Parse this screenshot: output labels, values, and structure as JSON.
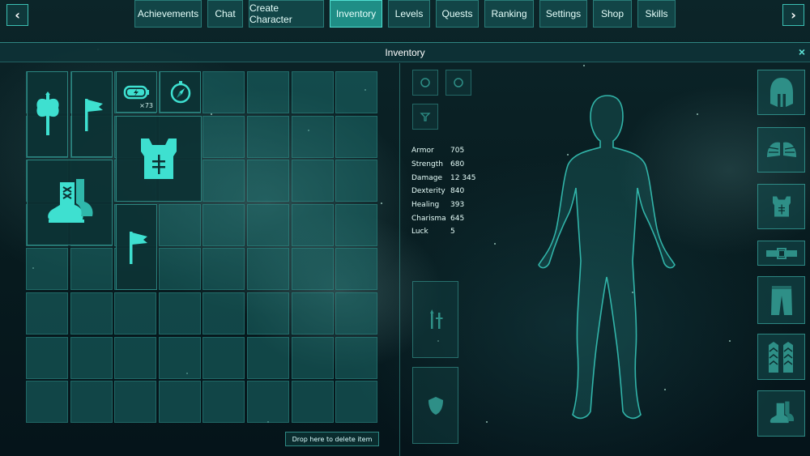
{
  "nav": {
    "prev_label": "‹",
    "next_label": "›",
    "tabs": [
      {
        "label": "Achievements",
        "active": false
      },
      {
        "label": "Chat",
        "active": false
      },
      {
        "label": "Create Character",
        "active": false
      },
      {
        "label": "Inventory",
        "active": true
      },
      {
        "label": "Levels",
        "active": false
      },
      {
        "label": "Quests",
        "active": false
      },
      {
        "label": "Ranking",
        "active": false
      },
      {
        "label": "Settings",
        "active": false
      },
      {
        "label": "Shop",
        "active": false
      },
      {
        "label": "Skills",
        "active": false
      }
    ]
  },
  "window": {
    "title": "Inventory",
    "close_label": "×"
  },
  "inventory": {
    "items": [
      {
        "icon": "battle-axe-icon"
      },
      {
        "icon": "flag-icon"
      },
      {
        "icon": "battery-icon",
        "quantity": "×73"
      },
      {
        "icon": "compass-icon"
      },
      {
        "icon": "chest-armor-icon"
      },
      {
        "icon": "boots-icon"
      },
      {
        "icon": "flag-icon"
      }
    ],
    "delete_label": "Drop here to delete item"
  },
  "stats": [
    {
      "name": "Armor",
      "value": "705"
    },
    {
      "name": "Strength",
      "value": "680"
    },
    {
      "name": "Damage",
      "value": "12 345"
    },
    {
      "name": "Dexterity",
      "value": "840"
    },
    {
      "name": "Healing",
      "value": "393"
    },
    {
      "name": "Charisma",
      "value": "645"
    },
    {
      "name": "Luck",
      "value": "5"
    }
  ],
  "equipment_slots": [
    "helmet-icon",
    "pauldrons-icon",
    "chest-armor-icon",
    "belt-icon",
    "pants-icon",
    "gauntlets-icon",
    "boots-icon"
  ],
  "colors": {
    "accent": "#3ee0d0",
    "active_tab": "#1f8e86",
    "panel": "#0c3032"
  }
}
